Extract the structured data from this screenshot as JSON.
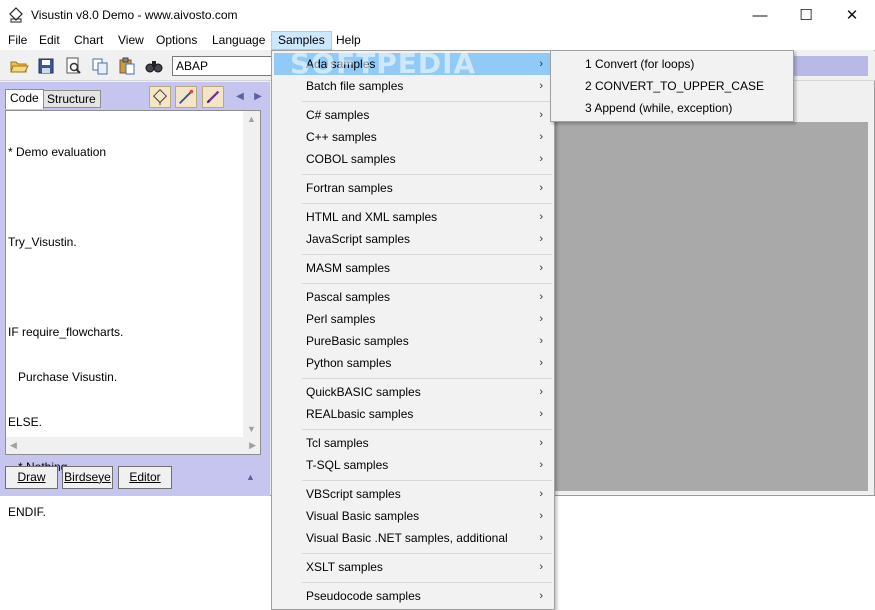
{
  "window": {
    "title": "Visustin v8.0 Demo - www.aivosto.com",
    "min_glyph": "—",
    "max_glyph": "☐",
    "close_glyph": "✕"
  },
  "menubar": {
    "items": [
      "File",
      "Edit",
      "Chart",
      "View",
      "Options",
      "Language",
      "Samples",
      "Help"
    ],
    "open_item": "Samples"
  },
  "toolbar": {
    "language": "ABAP",
    "icons": [
      "open-folder-icon",
      "save-icon",
      "print-preview-icon",
      "copy-icon",
      "paste-icon",
      "find-icon"
    ]
  },
  "left_panel": {
    "tabs": [
      "Code",
      "Structure"
    ],
    "active_tab": "Code",
    "code_lines": [
      "* Demo evaluation",
      "",
      "Try_Visustin.",
      "",
      "IF require_flowcharts.",
      "   Purchase Visustin.",
      "ELSE.",
      "   * Nothing",
      "ENDIF."
    ],
    "buttons": {
      "draw": "Draw",
      "birdseye": "Birdseye",
      "editor": "Editor"
    }
  },
  "samples_menu": {
    "items": [
      {
        "label": "Ada samples",
        "highlighted": true
      },
      {
        "label": "Batch file samples"
      },
      {
        "label": "C# samples"
      },
      {
        "label": "C++ samples"
      },
      {
        "label": "COBOL samples"
      },
      {
        "label": "Fortran samples"
      },
      {
        "label": "HTML and XML samples"
      },
      {
        "label": "JavaScript samples"
      },
      {
        "label": "MASM samples"
      },
      {
        "label": "Pascal samples"
      },
      {
        "label": "Perl samples"
      },
      {
        "label": "PureBasic samples"
      },
      {
        "label": "Python samples"
      },
      {
        "label": "QuickBASIC samples"
      },
      {
        "label": "REALbasic samples"
      },
      {
        "label": "Tcl samples"
      },
      {
        "label": "T-SQL samples"
      },
      {
        "label": "VBScript samples"
      },
      {
        "label": "Visual Basic samples"
      },
      {
        "label": "Visual Basic .NET samples, additional"
      },
      {
        "label": "XSLT samples"
      },
      {
        "label": "Pseudocode samples"
      }
    ],
    "chevron": "›"
  },
  "ada_submenu": {
    "items": [
      "1 Convert (for loops)",
      "2 CONVERT_TO_UPPER_CASE",
      "3 Append (while, exception)"
    ]
  },
  "watermark": "SOFTPEDIA",
  "colors": {
    "panel": "#c5c5f0",
    "chart_bg": "#a9a9a9",
    "menu_highlight": "#91c9f7"
  }
}
